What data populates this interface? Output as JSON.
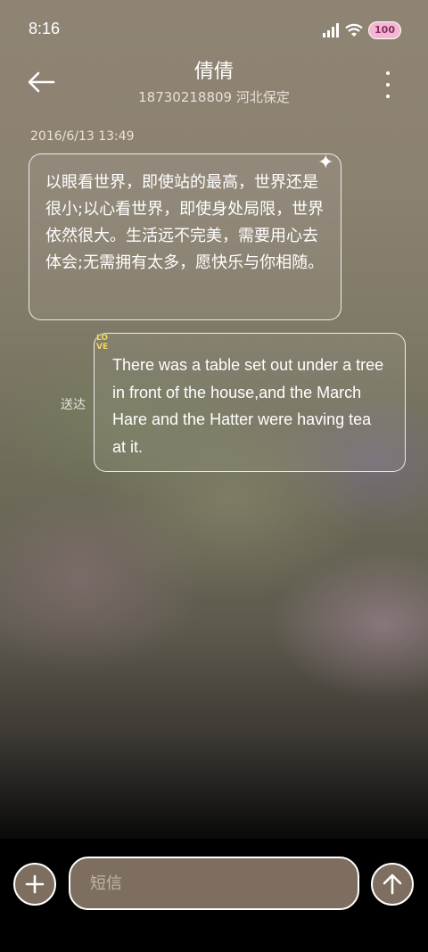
{
  "status_bar": {
    "time": "8:16",
    "battery": "100",
    "icons": [
      "signal-icon",
      "wifi-icon",
      "battery-icon"
    ]
  },
  "header": {
    "contact_name": "倩倩",
    "contact_info": "18730218809 河北保定",
    "icons": [
      "back-arrow-icon",
      "more-vertical-icon"
    ]
  },
  "messages": {
    "timestamp": "2016/6/13 13:49",
    "incoming": {
      "text": "以眼看世界，即使站的最高，世界还是很小;以心看世界，即使身处局限，世界依然很大。生活远不完美，需要用心去体会;无需拥有太多，愿快乐与你相随。"
    },
    "outgoing": {
      "text": "There was a table set out under a tree in front of the house,and the March Hare and the Hatter were having tea at it.",
      "badge_line1": "LO",
      "badge_line2": "VE",
      "status": "送达"
    }
  },
  "composer": {
    "placeholder": "短信",
    "value": "",
    "icons": [
      "add-icon",
      "send-arrow-icon"
    ]
  },
  "colors": {
    "button_fill": "#7d6e60",
    "badge_pink": "#f3b7d3",
    "love_yellow": "#f4dd6b"
  }
}
